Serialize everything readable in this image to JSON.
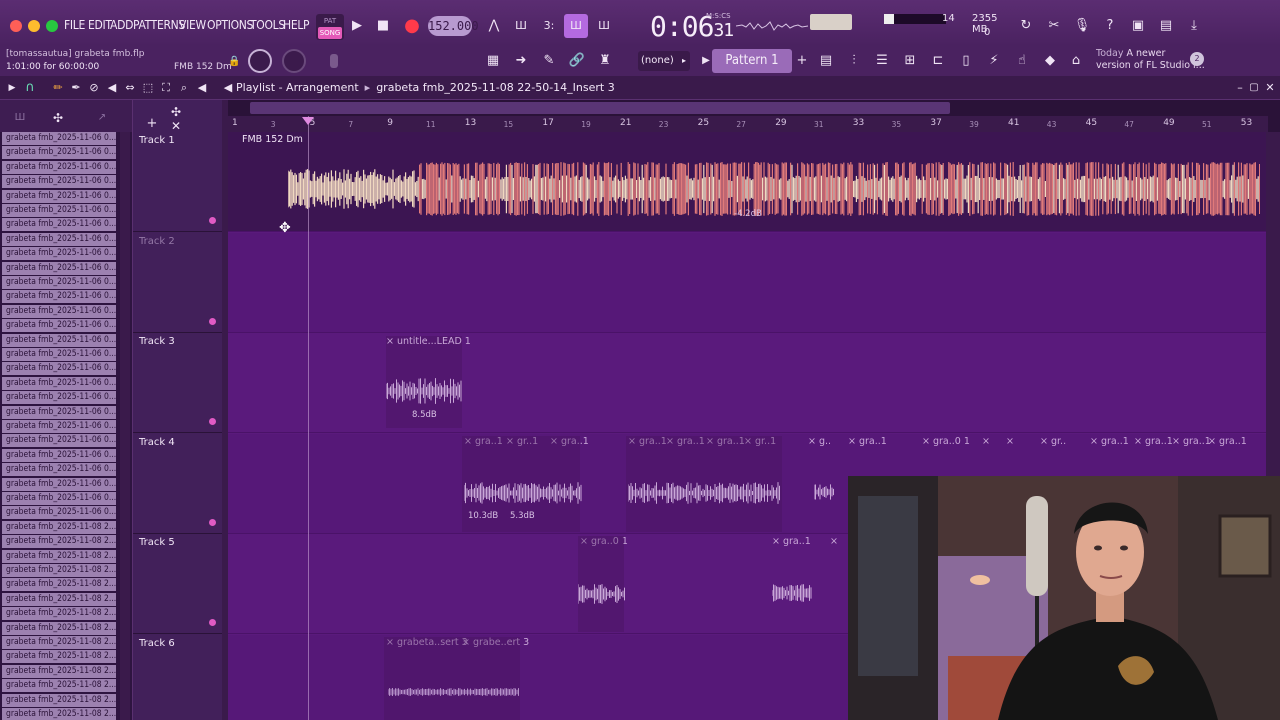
{
  "menubar": {
    "items": [
      "FILE",
      "EDIT",
      "ADD",
      "PATTERNS",
      "VIEW",
      "OPTIONS",
      "TOOLS",
      "HELP"
    ],
    "pat_label": "PAT",
    "song_label": "SONG",
    "tempo": "152.000",
    "time": "0:06",
    "time_small": "31",
    "time_unit": "M:S:CS",
    "cpu_voices": "14",
    "memory": "2355 MB",
    "cpu_second": "0"
  },
  "bar2": {
    "project_line": "[tomassautua] grabeta fmb.flp",
    "hint_left": "1:01:00 for 60:00:00",
    "hint_right": "FMB 152 Dm",
    "channel": "(none)",
    "pattern": "Pattern 1",
    "news_today": "Today",
    "news_text_1": "A newer",
    "news_text_2": "version of FL Studio i...",
    "news_count": "2"
  },
  "playlist": {
    "title": "Playlist - Arrangement",
    "breadcrumb": "grabeta fmb_2025-11-08 22-50-14_Insert 3"
  },
  "browser": {
    "items": [
      "grabeta fmb_2025-11-06 0...",
      "grabeta fmb_2025-11-06 0...",
      "grabeta fmb_2025-11-06 0...",
      "grabeta fmb_2025-11-06 0...",
      "grabeta fmb_2025-11-06 0...",
      "grabeta fmb_2025-11-06 0...",
      "grabeta fmb_2025-11-06 0...",
      "grabeta fmb_2025-11-06 0...",
      "grabeta fmb_2025-11-06 0...",
      "grabeta fmb_2025-11-06 0...",
      "grabeta fmb_2025-11-06 0...",
      "grabeta fmb_2025-11-06 0...",
      "grabeta fmb_2025-11-06 0...",
      "grabeta fmb_2025-11-06 0...",
      "grabeta fmb_2025-11-06 0...",
      "grabeta fmb_2025-11-06 0...",
      "grabeta fmb_2025-11-06 0...",
      "grabeta fmb_2025-11-06 0...",
      "grabeta fmb_2025-11-06 0...",
      "grabeta fmb_2025-11-06 0...",
      "grabeta fmb_2025-11-06 0...",
      "grabeta fmb_2025-11-06 0...",
      "grabeta fmb_2025-11-06 0...",
      "grabeta fmb_2025-11-06 0...",
      "grabeta fmb_2025-11-06 0...",
      "grabeta fmb_2025-11-06 0...",
      "grabeta fmb_2025-11-06 0...",
      "grabeta fmb_2025-11-08 2...",
      "grabeta fmb_2025-11-08 2...",
      "grabeta fmb_2025-11-08 2...",
      "grabeta fmb_2025-11-08 2...",
      "grabeta fmb_2025-11-08 2...",
      "grabeta fmb_2025-11-08 2...",
      "grabeta fmb_2025-11-08 2...",
      "grabeta fmb_2025-11-08 2...",
      "grabeta fmb_2025-11-08 2...",
      "grabeta fmb_2025-11-08 2...",
      "grabeta fmb_2025-11-08 2...",
      "grabeta fmb_2025-11-08 2...",
      "grabeta fmb_2025-11-08 2...",
      "grabeta fmb_2025-11-08 2..."
    ]
  },
  "tracks": [
    "Track 1",
    "Track 2",
    "Track 3",
    "Track 4",
    "Track 5",
    "Track 6"
  ],
  "ruler": {
    "major": [
      "1",
      "5",
      "9",
      "13",
      "17",
      "21",
      "25",
      "29",
      "33",
      "37",
      "41",
      "45",
      "49",
      "53"
    ],
    "minor": [
      "3",
      "7",
      "11",
      "15",
      "19",
      "23",
      "27",
      "31",
      "35",
      "39",
      "43",
      "47",
      "51"
    ]
  },
  "clips": {
    "t1_label": "FMB 152 Dm",
    "t1_db": "-4.2dB",
    "t3_label": "× untitle...LEAD 1",
    "t3_db": "8.5dB",
    "t4_labels": [
      "× gra..1",
      "× gr..1",
      "× gra..1",
      "× gra..1",
      "× gra..1",
      "× gra..1",
      "× gr..1",
      "× g..",
      "× gra..1",
      "× gra..0 1",
      "×",
      "×",
      "× gr..",
      "× gra..1",
      "× gra..1",
      "× gra..1",
      "× gra..1"
    ],
    "t4_db1": "10.3dB",
    "t4_db2": "5.3dB",
    "t5_labels": [
      "× gra..0 1",
      "× gra..1",
      "×"
    ],
    "t6_labels": [
      "× grabeta..sert 3",
      "× grabe..ert 3"
    ]
  },
  "colors": {
    "accent": "#e05ac4",
    "grid": "#5a1a7c",
    "waveform_hot": "#e07a7a",
    "waveform_light": "#f0d8c0"
  }
}
